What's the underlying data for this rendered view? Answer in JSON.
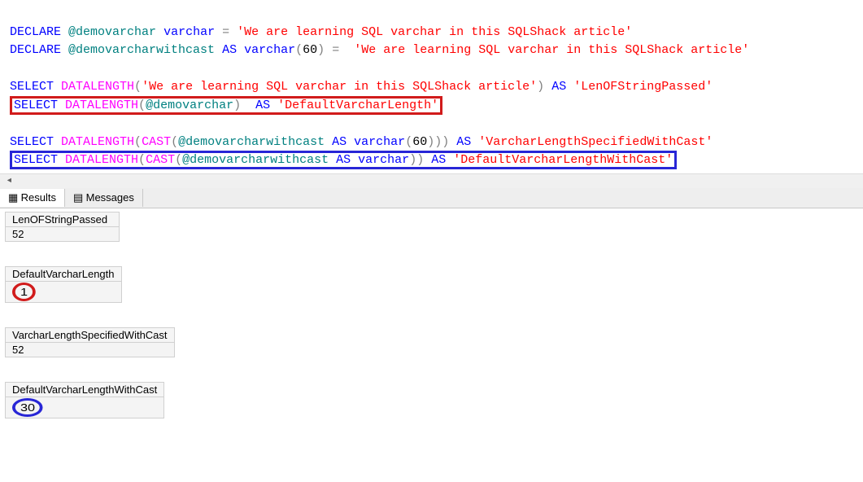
{
  "sql": {
    "declare1_var": "@demovarchar",
    "declare1_type": "varchar",
    "declare1_val": "'We are learning SQL varchar in this SQLShack article'",
    "declare2_var": "@demovarcharwithcast",
    "declare2_type": "varchar",
    "declare2_len": "60",
    "declare2_val": "'We are learning SQL varchar in this SQLShack article'",
    "sel1_str": "'We are learning SQL varchar in this SQLShack article'",
    "sel1_alias": "'LenOFStringPassed'",
    "sel2_arg": "@demovarchar",
    "sel2_alias": "'DefaultVarcharLength'",
    "sel3_arg": "@demovarcharwithcast",
    "sel3_type": "varchar",
    "sel3_len": "60",
    "sel3_alias": "'VarcharLengthSpecifiedWithCast'",
    "sel4_arg": "@demovarcharwithcast",
    "sel4_type": "varchar",
    "sel4_alias": "'DefaultVarcharLengthWithCast'",
    "kw_declare": "DECLARE",
    "kw_as": "AS",
    "kw_select": "SELECT",
    "fn_datalength": "DATALENGTH",
    "fn_cast": "CAST"
  },
  "tabs": {
    "results": "Results",
    "messages": "Messages"
  },
  "results": {
    "r1_header": "LenOFStringPassed",
    "r1_value": "52",
    "r2_header": "DefaultVarcharLength",
    "r2_value": "1",
    "r3_header": "VarcharLengthSpecifiedWithCast",
    "r3_value": "52",
    "r4_header": "DefaultVarcharLengthWithCast",
    "r4_value": "30"
  }
}
